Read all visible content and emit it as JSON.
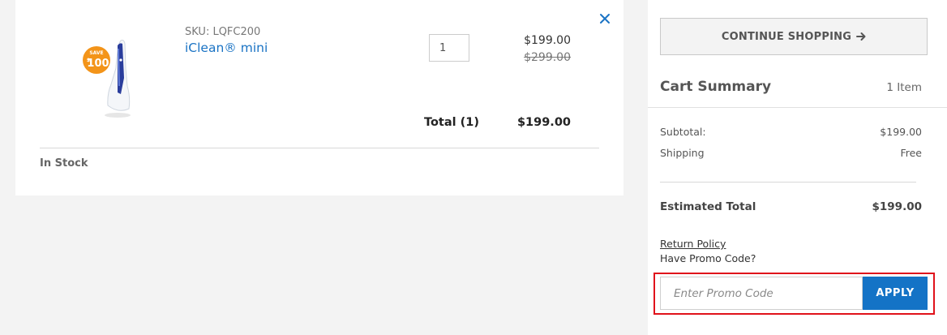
{
  "colors": {
    "accent_blue": "#1473c6",
    "link_blue": "#1a73c4",
    "badge_orange": "#f39419",
    "highlight_red": "#e0121b",
    "page_bg": "#f3f3f3"
  },
  "cart_item": {
    "image_icon": "product-toothbrush-image",
    "badge": {
      "top": "SAVE",
      "amount": "100",
      "currency": "$"
    },
    "sku_label": "SKU: LQFC200",
    "name": "iClean® mini",
    "quantity": "1",
    "price_now": "$199.00",
    "price_was": "$299.00",
    "total_label": "Total (1)",
    "total_value": "$199.00",
    "stock_status": "In Stock",
    "remove_icon": "close-icon"
  },
  "summary": {
    "continue_label": "CONTINUE SHOPPING",
    "continue_icon": "arrow-right-icon",
    "title": "Cart Summary",
    "item_count": "1 Item",
    "subtotal_label": "Subtotal:",
    "subtotal_value": "$199.00",
    "shipping_label": "Shipping",
    "shipping_value": "Free",
    "estimated_label": "Estimated Total",
    "estimated_value": "$199.00",
    "return_policy": "Return Policy",
    "promo_question": "Have Promo Code?",
    "promo_placeholder": "Enter Promo Code",
    "apply_label": "APPLY"
  }
}
